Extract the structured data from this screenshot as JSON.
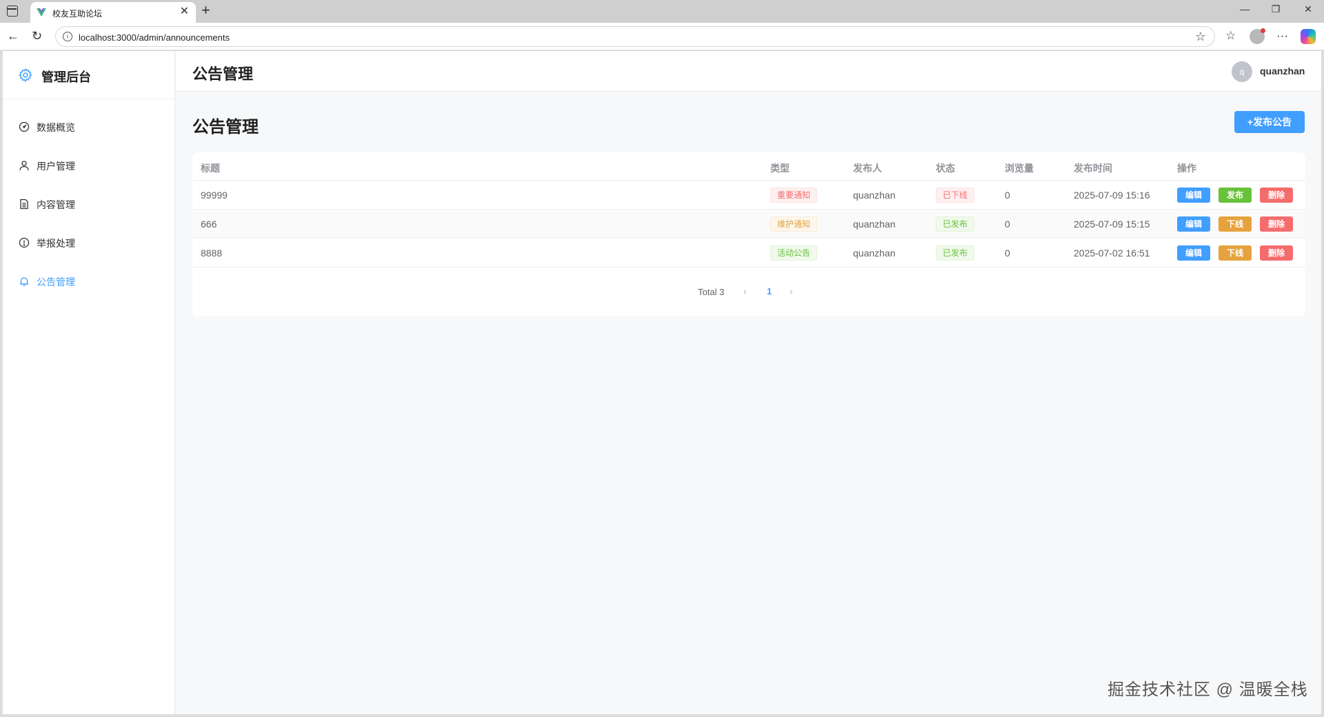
{
  "browser": {
    "tab_title": "校友互助论坛",
    "url": "localhost:3000/admin/announcements"
  },
  "sidebar": {
    "title": "管理后台",
    "items": [
      {
        "label": "数据概览",
        "icon": "dashboard-icon"
      },
      {
        "label": "用户管理",
        "icon": "user-icon"
      },
      {
        "label": "内容管理",
        "icon": "document-icon"
      },
      {
        "label": "举报处理",
        "icon": "alert-icon"
      },
      {
        "label": "公告管理",
        "icon": "bell-icon",
        "active": true
      }
    ]
  },
  "header": {
    "title": "公告管理",
    "avatar_letter": "q",
    "username": "quanzhan"
  },
  "main": {
    "title": "公告管理",
    "publish_button": "+发布公告",
    "table": {
      "columns": [
        "标题",
        "类型",
        "发布人",
        "状态",
        "浏览量",
        "发布时间",
        "操作"
      ],
      "rows": [
        {
          "title": "99999",
          "type": "重要通知",
          "type_style": "danger",
          "publisher": "quanzhan",
          "status": "已下线",
          "status_style": "danger",
          "views": "0",
          "time": "2025-07-09 15:16",
          "action": "发布",
          "action_style": "publish"
        },
        {
          "title": "666",
          "type": "维护通知",
          "type_style": "warning",
          "publisher": "quanzhan",
          "status": "已发布",
          "status_style": "success",
          "views": "0",
          "time": "2025-07-09 15:15",
          "action": "下线",
          "action_style": "offline"
        },
        {
          "title": "8888",
          "type": "活动公告",
          "type_style": "success",
          "publisher": "quanzhan",
          "status": "已发布",
          "status_style": "success",
          "views": "0",
          "time": "2025-07-02 16:51",
          "action": "下线",
          "action_style": "offline"
        }
      ],
      "edit_label": "编辑",
      "delete_label": "删除"
    },
    "pagination": {
      "total": "Total 3",
      "current_page": "1"
    }
  },
  "watermark": "掘金技术社区 @ 温暖全栈",
  "colors": {
    "primary": "#409eff",
    "success": "#67c23a",
    "warning": "#e6a23c",
    "danger": "#f56c6c"
  }
}
